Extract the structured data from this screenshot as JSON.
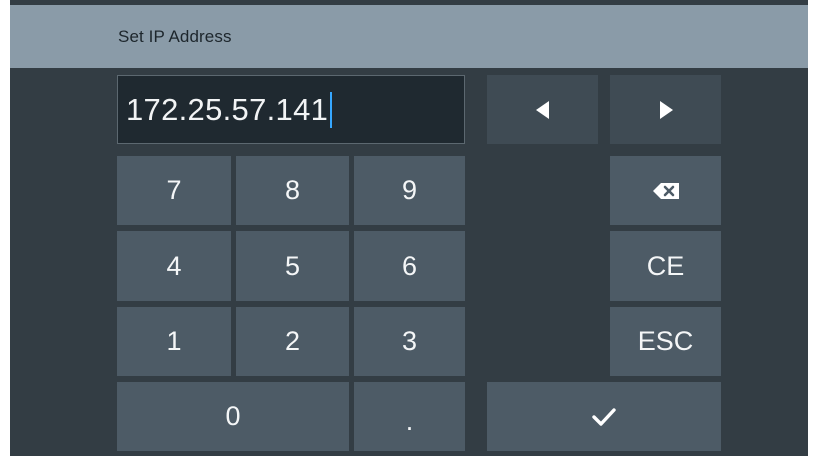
{
  "dialog": {
    "title": "Set IP Address"
  },
  "input": {
    "value": "172.25.57.141"
  },
  "keypad": {
    "digits": {
      "seven": "7",
      "eight": "8",
      "nine": "9",
      "four": "4",
      "five": "5",
      "six": "6",
      "one": "1",
      "two": "2",
      "three": "3",
      "zero": "0",
      "dot": "."
    },
    "ce_label": "CE",
    "esc_label": "ESC"
  },
  "icons": {
    "left": "arrow-left-icon",
    "right": "arrow-right-icon",
    "backspace": "backspace-icon",
    "enter": "checkmark-icon"
  },
  "colors": {
    "title_bar": "#8a9ba8",
    "panel": "#333d44",
    "key": "#4d5b66",
    "key_dark": "#3f4b54",
    "caret": "#36a7ff"
  }
}
